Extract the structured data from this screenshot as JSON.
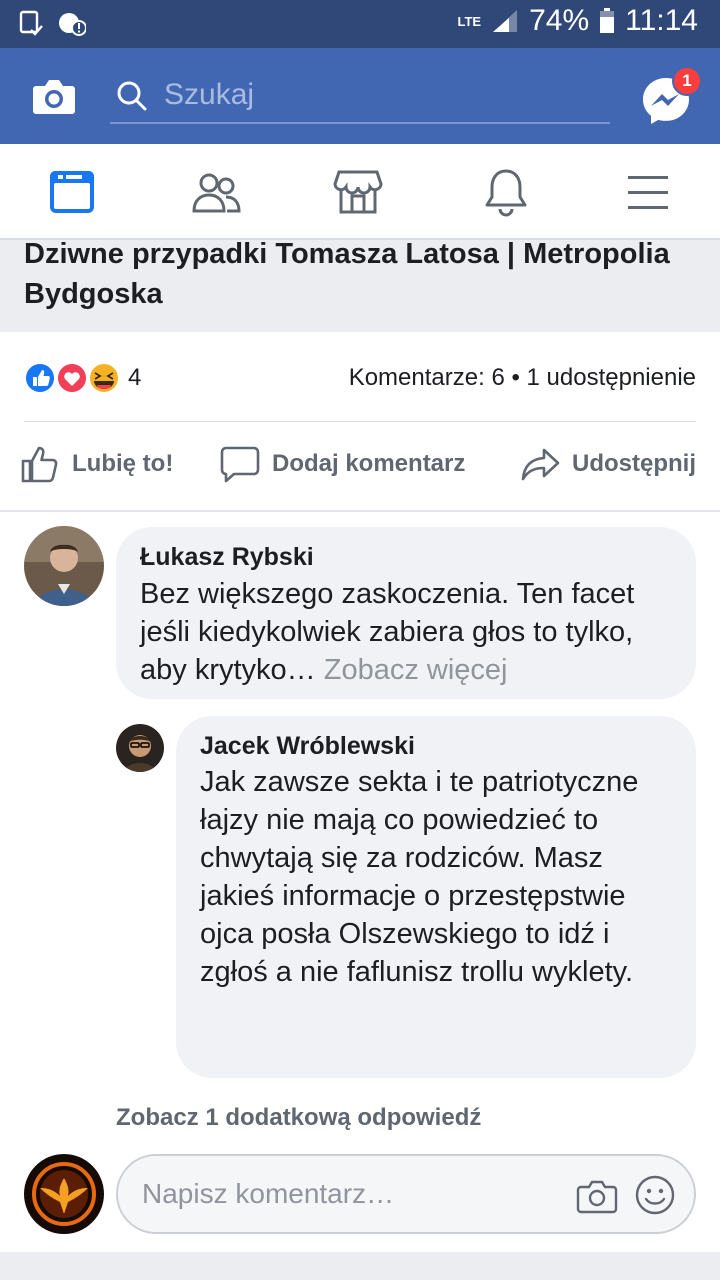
{
  "status_bar": {
    "network": "LTE",
    "battery": "74%",
    "time": "11:14"
  },
  "top_bar": {
    "search_placeholder": "Szukaj",
    "messenger_badge": "1",
    "colors": {
      "brand": "#4267b2",
      "badge": "#fa3e3e"
    }
  },
  "nav": {
    "items": [
      "news-feed-icon",
      "friends-icon",
      "marketplace-icon",
      "notifications-icon",
      "menu-icon"
    ],
    "active": "news-feed-icon"
  },
  "post": {
    "title": "Dziwne przypadki Tomasza Latosa | Metropolia Bydgoska",
    "reaction_count": "4",
    "reactions": [
      "like",
      "love",
      "haha"
    ],
    "comments_shares": "Komentarze: 6 • 1 udostępnienie",
    "actions": {
      "like": "Lubię to!",
      "comment": "Dodaj komentarz",
      "share": "Udostępnij"
    }
  },
  "comments": [
    {
      "author": "Łukasz Rybski",
      "text": "Bez większego zaskoczenia. Ten facet jeśli kiedykolwiek zabiera głos to tylko, aby krytyko…",
      "see_more": "Zobacz więcej"
    }
  ],
  "replies": [
    {
      "author": "Jacek Wróblewski",
      "text": "Jak zawsze sekta i te patriotyczne łajzy nie mają co powiedzieć to chwytają się za rodziców. Masz jakieś informacje o przestępstwie ojca posła Olszewskiego to idź i zgłoś a nie faflunisz trollu wyklety."
    }
  ],
  "more_replies": "Zobacz 1 dodatkową odpowiedź",
  "composer": {
    "placeholder": "Napisz komentarz…"
  }
}
